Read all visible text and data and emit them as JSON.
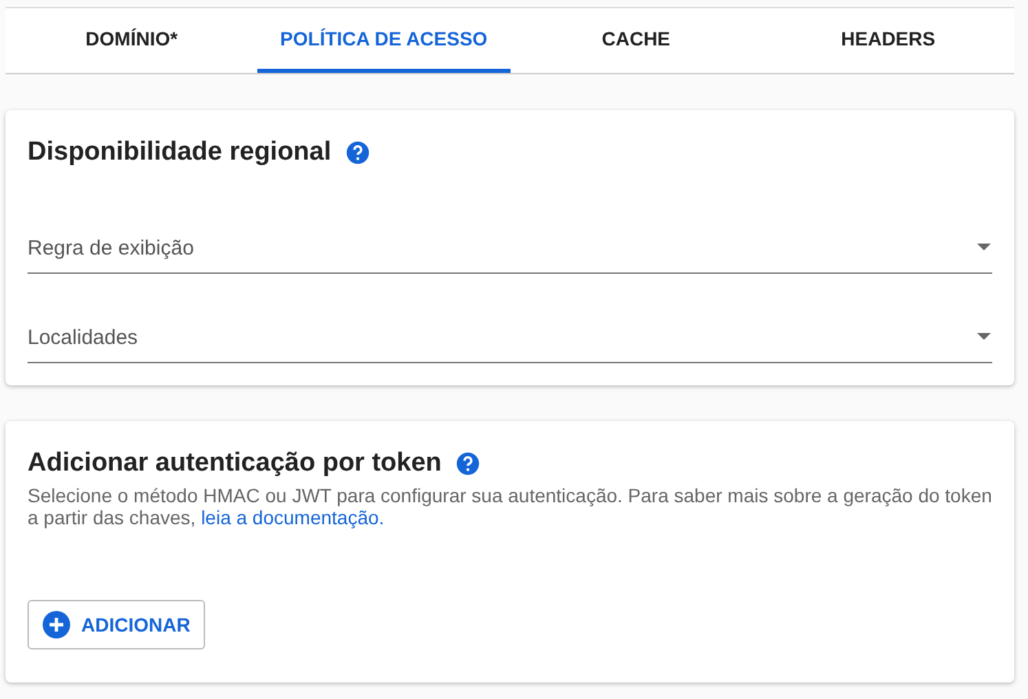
{
  "tabs": [
    {
      "label": "DOMÍNIO*",
      "selected": false
    },
    {
      "label": "POLÍTICA DE ACESSO",
      "selected": true
    },
    {
      "label": "CACHE",
      "selected": false
    },
    {
      "label": "HEADERS",
      "selected": false
    }
  ],
  "regional": {
    "title": "Disponibilidade regional",
    "fields": [
      {
        "label": "Regra de exibição"
      },
      {
        "label": "Localidades"
      }
    ]
  },
  "token": {
    "title": "Adicionar autenticação por token",
    "description": "Selecione o método HMAC ou JWT para configurar sua autenticação. Para saber mais sobre a geração do token a partir das chaves,",
    "link": "leia a documentação.",
    "button": "ADICIONAR"
  }
}
